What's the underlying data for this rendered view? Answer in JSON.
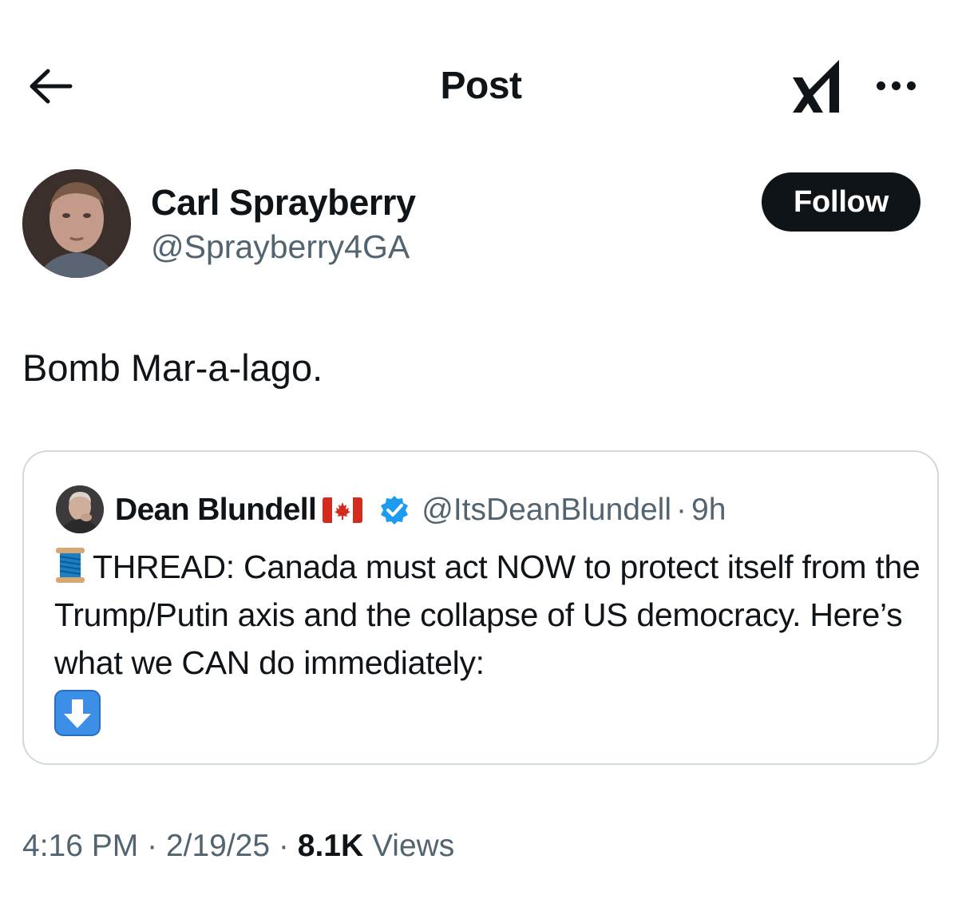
{
  "header": {
    "title": "Post",
    "back_icon": "arrow-left-icon",
    "grok_icon": "grok-icon",
    "more_icon": "more-horizontal-icon"
  },
  "author": {
    "name": "Carl Sprayberry",
    "handle": "@Sprayberry4GA",
    "follow_label": "Follow"
  },
  "post": {
    "text": "Bomb Mar-a-lago."
  },
  "quote": {
    "name": "Dean Blundell",
    "flag_icon": "canada-flag-icon",
    "verified_icon": "verified-badge-icon",
    "handle": "@ItsDeanBlundell",
    "separator": "·",
    "time": "9h",
    "spool_icon": "thread-spool-icon",
    "body": "THREAD: Canada must act NOW to protect itself from the Trump/Putin axis and the collapse of US democracy. Here’s what we CAN do immediately:",
    "arrow_icon": "down-arrow-icon"
  },
  "meta": {
    "time": "4:16 PM",
    "sep1": "·",
    "date": "2/19/25",
    "sep2": "·",
    "views_count": "8.1K",
    "views_label": "Views"
  },
  "colors": {
    "text": "#0f1419",
    "secondary": "#536471",
    "border": "#cfd9de",
    "verified": "#1d9bf0",
    "follow_bg": "#0f1419"
  }
}
